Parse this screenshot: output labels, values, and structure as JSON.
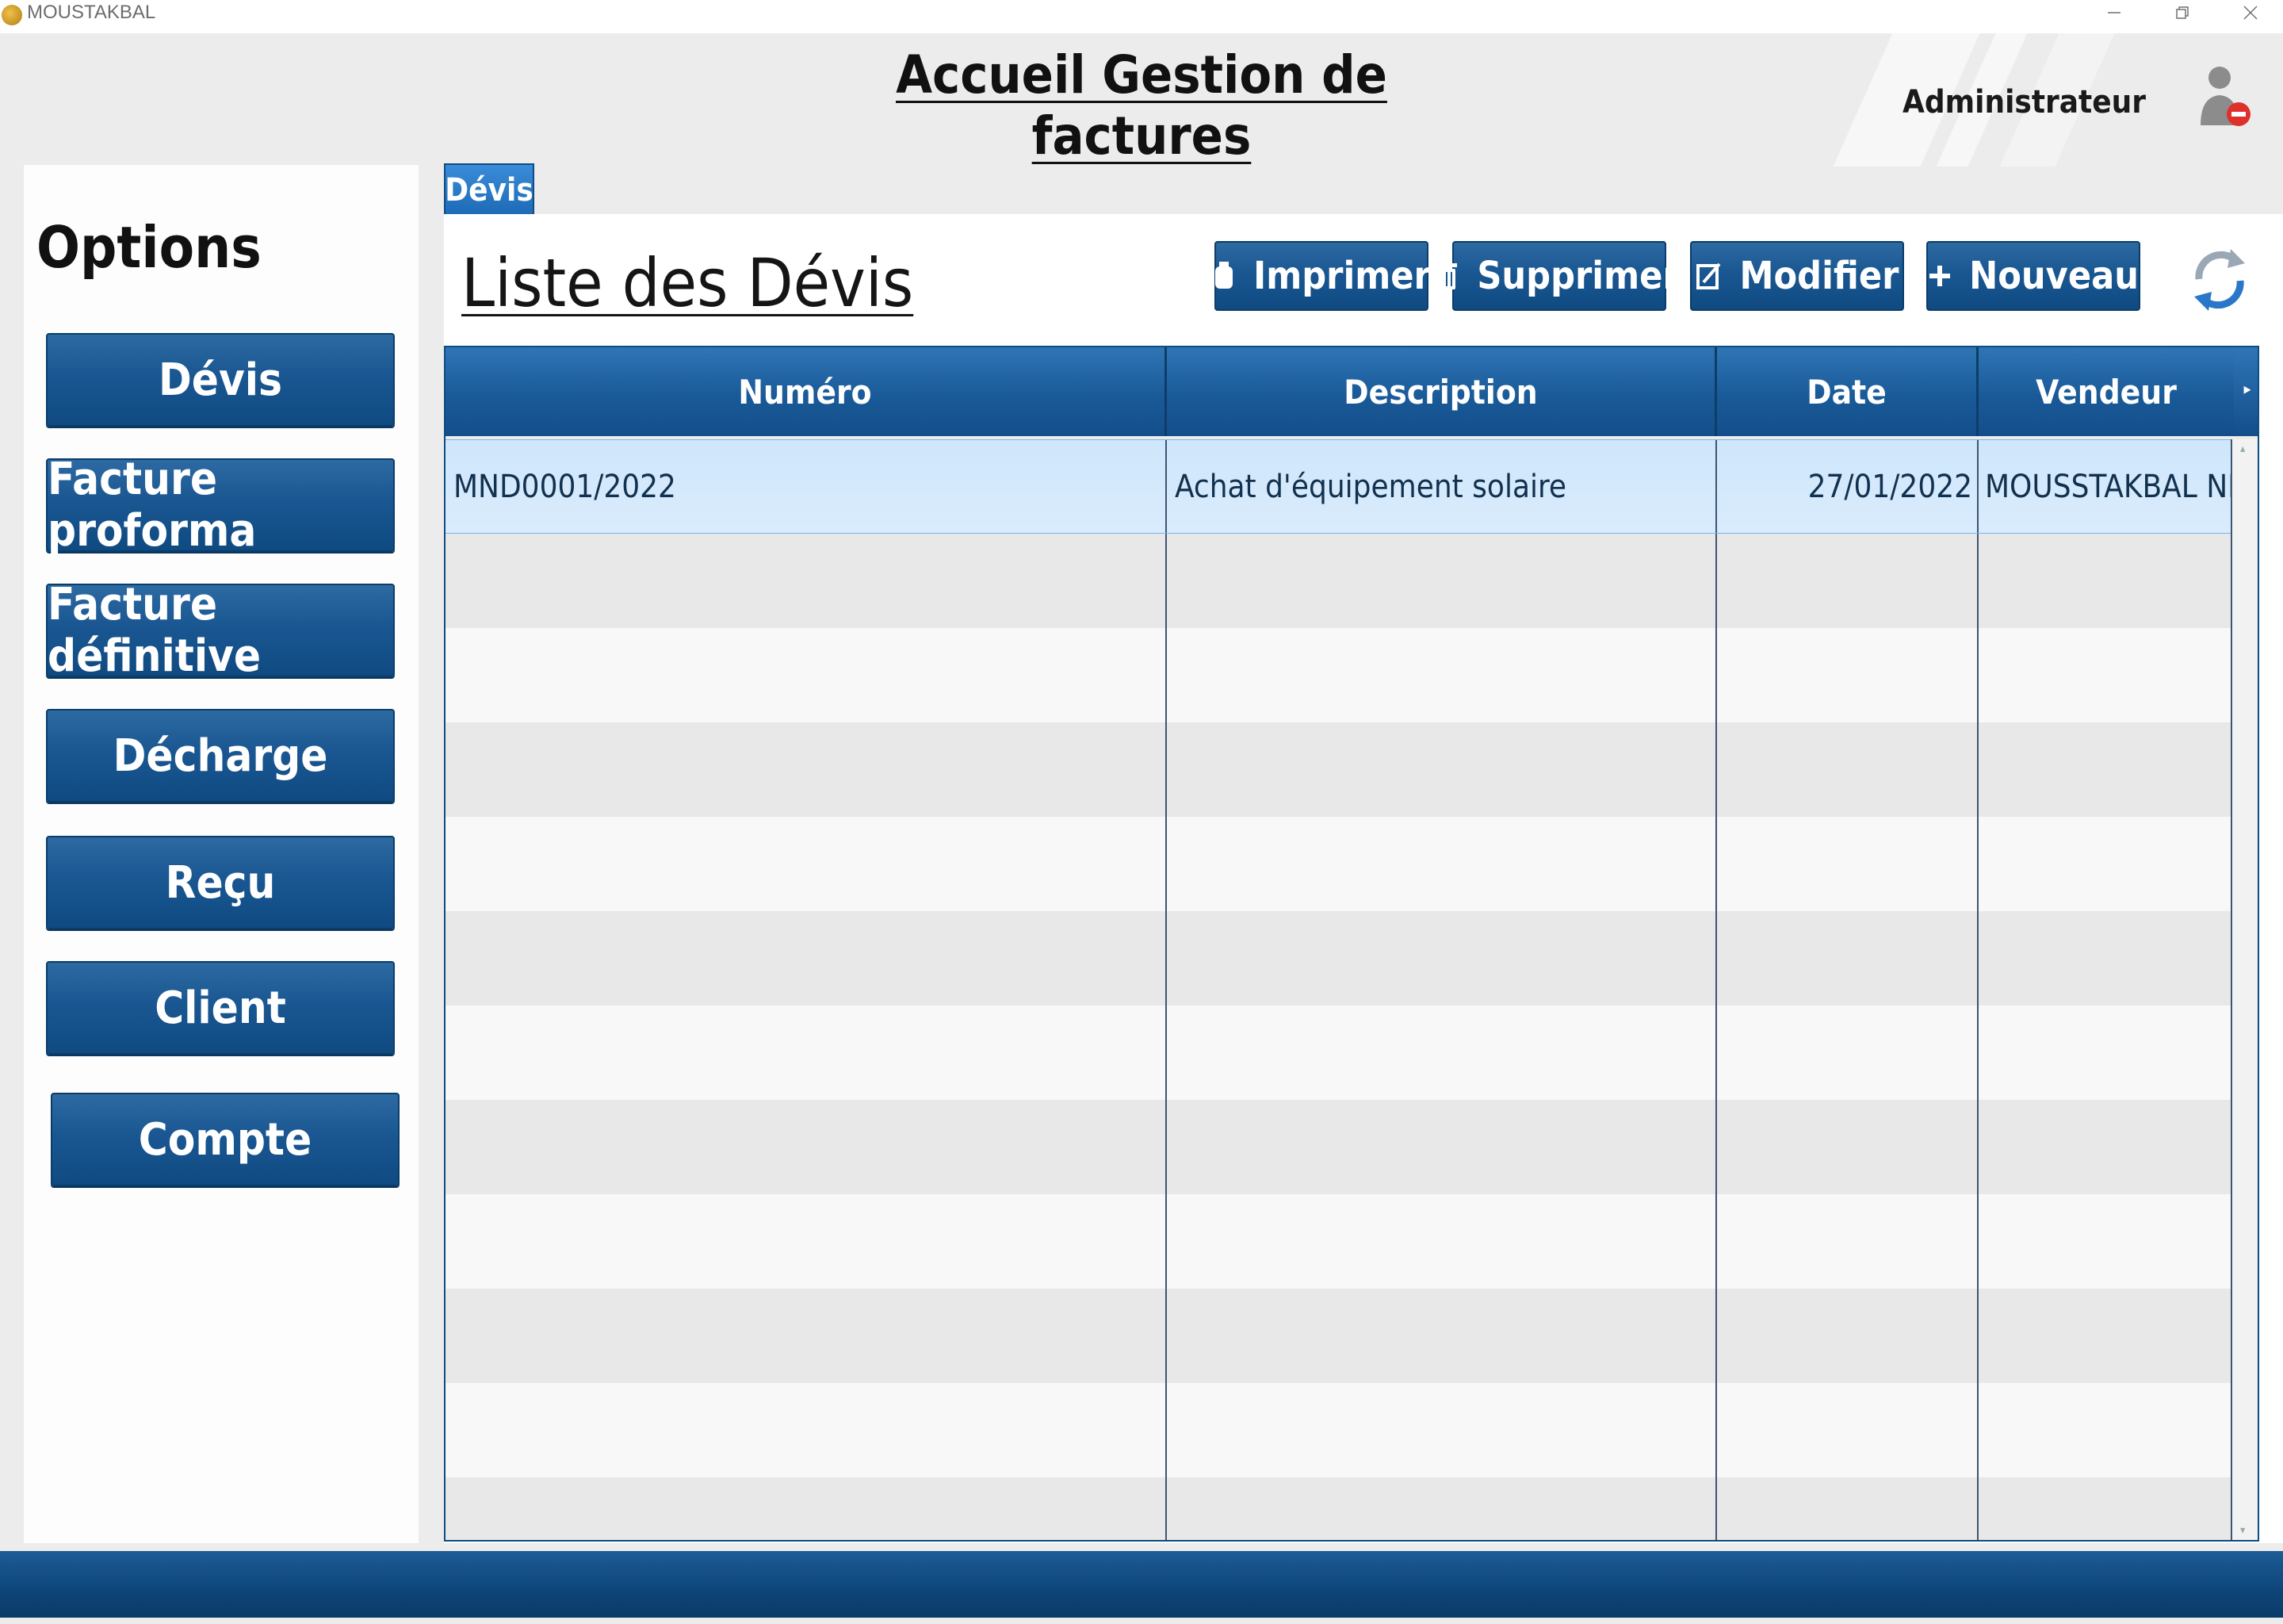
{
  "window": {
    "app_name": "MOUSTAKBAL",
    "controls": [
      "minimize-icon",
      "restore-icon",
      "close-icon"
    ]
  },
  "header": {
    "title": "Accueil Gestion de factures",
    "user_name": "Administrateur",
    "user_icon": "user-remove-icon"
  },
  "sidebar": {
    "title": "Options",
    "items": [
      {
        "label": "Dévis"
      },
      {
        "label": "Facture proforma"
      },
      {
        "label": "Facture définitive"
      },
      {
        "label": "Décharge"
      },
      {
        "label": "Reçu"
      },
      {
        "label": "Client"
      },
      {
        "label": "Compte"
      }
    ]
  },
  "tab": {
    "label": "Dévis"
  },
  "main": {
    "title": "Liste des Dévis",
    "toolbar": {
      "print_label": "Imprimer",
      "delete_label": "Supprimer",
      "edit_label": "Modifier",
      "new_label": "Nouveau",
      "refresh_icon": "refresh-icon"
    },
    "table": {
      "columns": [
        "Numéro",
        "Description",
        "Date",
        "Vendeur"
      ],
      "rows": [
        {
          "numero": "MND0001/2022",
          "description": "Achat d'équipement solaire",
          "date": "27/01/2022",
          "vendeur": "MOUSSTAKBAL NEGOC"
        }
      ]
    }
  },
  "colors": {
    "button_blue": "#1a5792",
    "header_blue": "#1a5a98",
    "selected_row": "#d4e9fc",
    "footer_blue": "#0d4578"
  }
}
